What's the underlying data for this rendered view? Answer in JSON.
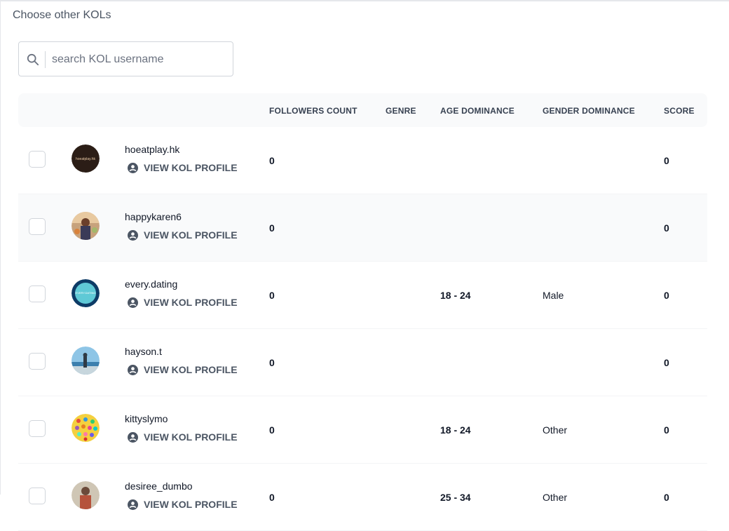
{
  "section_title": "Choose other KOLs",
  "search": {
    "placeholder": "search KOL username",
    "value": ""
  },
  "table": {
    "columns": {
      "followers": "FOLLOWERS COUNT",
      "genre": "GENRE",
      "age": "AGE DOMINANCE",
      "gender": "GENDER DOMINANCE",
      "score": "SCORE"
    },
    "profile_link_label": "VIEW KOL PROFILE",
    "rows": [
      {
        "username": "hoeatplay.hk",
        "followers": "0",
        "genre": "",
        "age": "",
        "gender": "",
        "score": "0",
        "avatar": "dark-logo"
      },
      {
        "username": "happykaren6",
        "followers": "0",
        "genre": "",
        "age": "",
        "gender": "",
        "score": "0",
        "avatar": "photo-warm"
      },
      {
        "username": "every.dating",
        "followers": "0",
        "genre": "",
        "age": "18 - 24",
        "gender": "Male",
        "score": "0",
        "avatar": "teal-circle"
      },
      {
        "username": "hayson.t",
        "followers": "0",
        "genre": "",
        "age": "",
        "gender": "",
        "score": "0",
        "avatar": "photo-sky"
      },
      {
        "username": "kittyslymo",
        "followers": "0",
        "genre": "",
        "age": "18 - 24",
        "gender": "Other",
        "score": "0",
        "avatar": "colorful-dots"
      },
      {
        "username": "desiree_dumbo",
        "followers": "0",
        "genre": "",
        "age": "25 - 34",
        "gender": "Other",
        "score": "0",
        "avatar": "photo-person"
      }
    ]
  }
}
